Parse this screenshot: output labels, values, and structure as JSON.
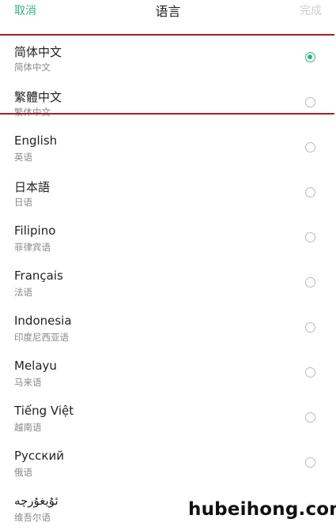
{
  "header": {
    "cancel_label": "取消",
    "title": "语言",
    "done_label": "完成"
  },
  "colors": {
    "accent": "#2fb57e",
    "highlight_frame": "#a31f24"
  },
  "languages": [
    {
      "name": "简体中文",
      "sub": "简体中文",
      "selected": true
    },
    {
      "name": "繁體中文",
      "sub": "繁体中文",
      "selected": false
    },
    {
      "name": "English",
      "sub": "英语",
      "selected": false
    },
    {
      "name": "日本語",
      "sub": "日语",
      "selected": false
    },
    {
      "name": "Filipino",
      "sub": "菲律宾语",
      "selected": false
    },
    {
      "name": "Français",
      "sub": "法语",
      "selected": false
    },
    {
      "name": "Indonesia",
      "sub": "印度尼西亚语",
      "selected": false
    },
    {
      "name": "Melayu",
      "sub": "马来语",
      "selected": false
    },
    {
      "name": "Tiếng Việt",
      "sub": "越南语",
      "selected": false
    },
    {
      "name": "Русский",
      "sub": "俄语",
      "selected": false
    },
    {
      "name": "ئۇيغۇرچە",
      "sub": "维吾尔语",
      "selected": false
    }
  ],
  "watermark": "hubeihong.com"
}
